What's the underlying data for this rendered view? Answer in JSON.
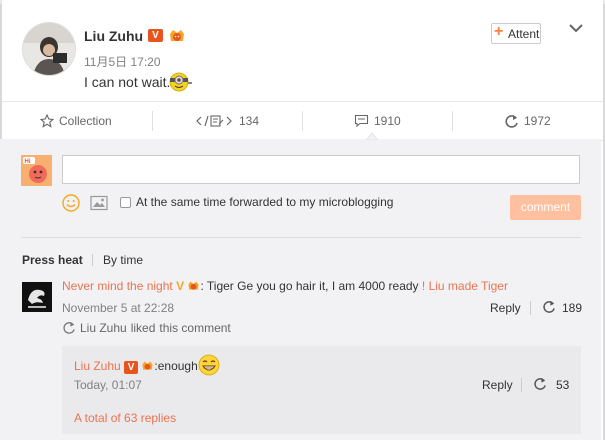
{
  "post": {
    "author": "Liu Zuhu",
    "verified_mark": "V",
    "time": "11月5日 17:20",
    "text": "I can not wait.",
    "follow_label": "Attention",
    "follow_plus": "+"
  },
  "actions": {
    "collection": "Collection",
    "share_count": "134",
    "comment_count": "1910",
    "like_count": "1972"
  },
  "composer": {
    "input_value": "",
    "avatar_text": "Hi",
    "forward_label": "At the same time forwarded to my microblogging",
    "submit_label": "comment"
  },
  "sort": {
    "hot": "Press heat",
    "time": "By time"
  },
  "comments": [
    {
      "author": "Never mind the night",
      "verified_mark": "V",
      "text": ": Tiger Ge you go hair it, I am 4000 ready",
      "link_text": "! Liu made Tiger",
      "time": "November 5 at 22:28",
      "reply_label": "Reply",
      "count": "189",
      "liked_by": "Liu Zuhu",
      "liked_text": "liked",
      "liked_suffix": "this comment",
      "replies": [
        {
          "author": "Liu Zuhu",
          "verified_mark": "V",
          "text": ":enough",
          "time": "Today, 01:07",
          "reply_label": "Reply",
          "count": "53"
        }
      ],
      "total_replies": "A total of 63 replies"
    }
  ],
  "colors": {
    "accent": "#eb7350",
    "button_disabled": "#ffc09f",
    "verified": "#e8541e"
  }
}
